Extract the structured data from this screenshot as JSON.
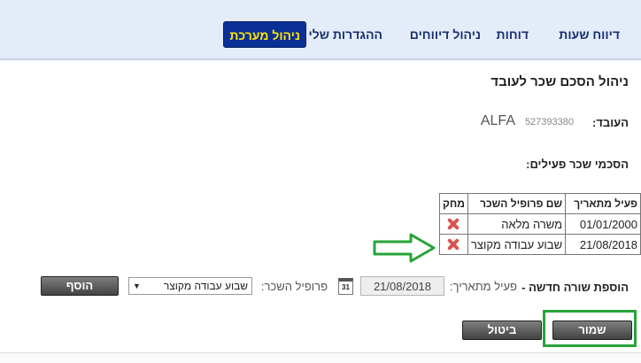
{
  "nav": {
    "items": [
      {
        "label": "דיווח שעות"
      },
      {
        "label": "דוחות"
      },
      {
        "label": "ניהול דיווחים"
      },
      {
        "label": "ההגדרות שלי"
      },
      {
        "label": "ניהול מערכת",
        "active": true
      }
    ]
  },
  "page": {
    "title": "ניהול הסכם שכר לעובד"
  },
  "employee": {
    "label": "העובד:",
    "id": "527393380",
    "name": "ALFA"
  },
  "agreements": {
    "section_title": "הסכמי שכר פעילים:",
    "headers": {
      "from_date": "פעיל מתאריך",
      "profile": "שם פרופיל השכר",
      "delete": "מחק"
    },
    "rows": [
      {
        "from_date": "01/01/2000",
        "profile": "משרה מלאה"
      },
      {
        "from_date": "21/08/2018",
        "profile": "שבוע עבודה מקוצר"
      }
    ]
  },
  "new_row": {
    "label": "הוספת שורה חדשה -",
    "from_date_label": "פעיל מתאריך:",
    "from_date_value": "21/08/2018",
    "calendar_icon_text": "31",
    "profile_label": "פרופיל השכר:",
    "profile_value": "שבוע עבודה מקוצר",
    "add_button": "הוסף"
  },
  "actions": {
    "cancel": "ביטול",
    "save": "שמור"
  },
  "colors": {
    "nav_bg": "#e4ecfa",
    "active_tab_bg": "#0a2f96",
    "active_tab_text": "#ffe600",
    "highlight": "#27a33a",
    "delete_icon": "#d9534f"
  },
  "icons": [
    "delete-icon",
    "calendar-icon",
    "chevron-down-icon",
    "annotation-arrow"
  ]
}
